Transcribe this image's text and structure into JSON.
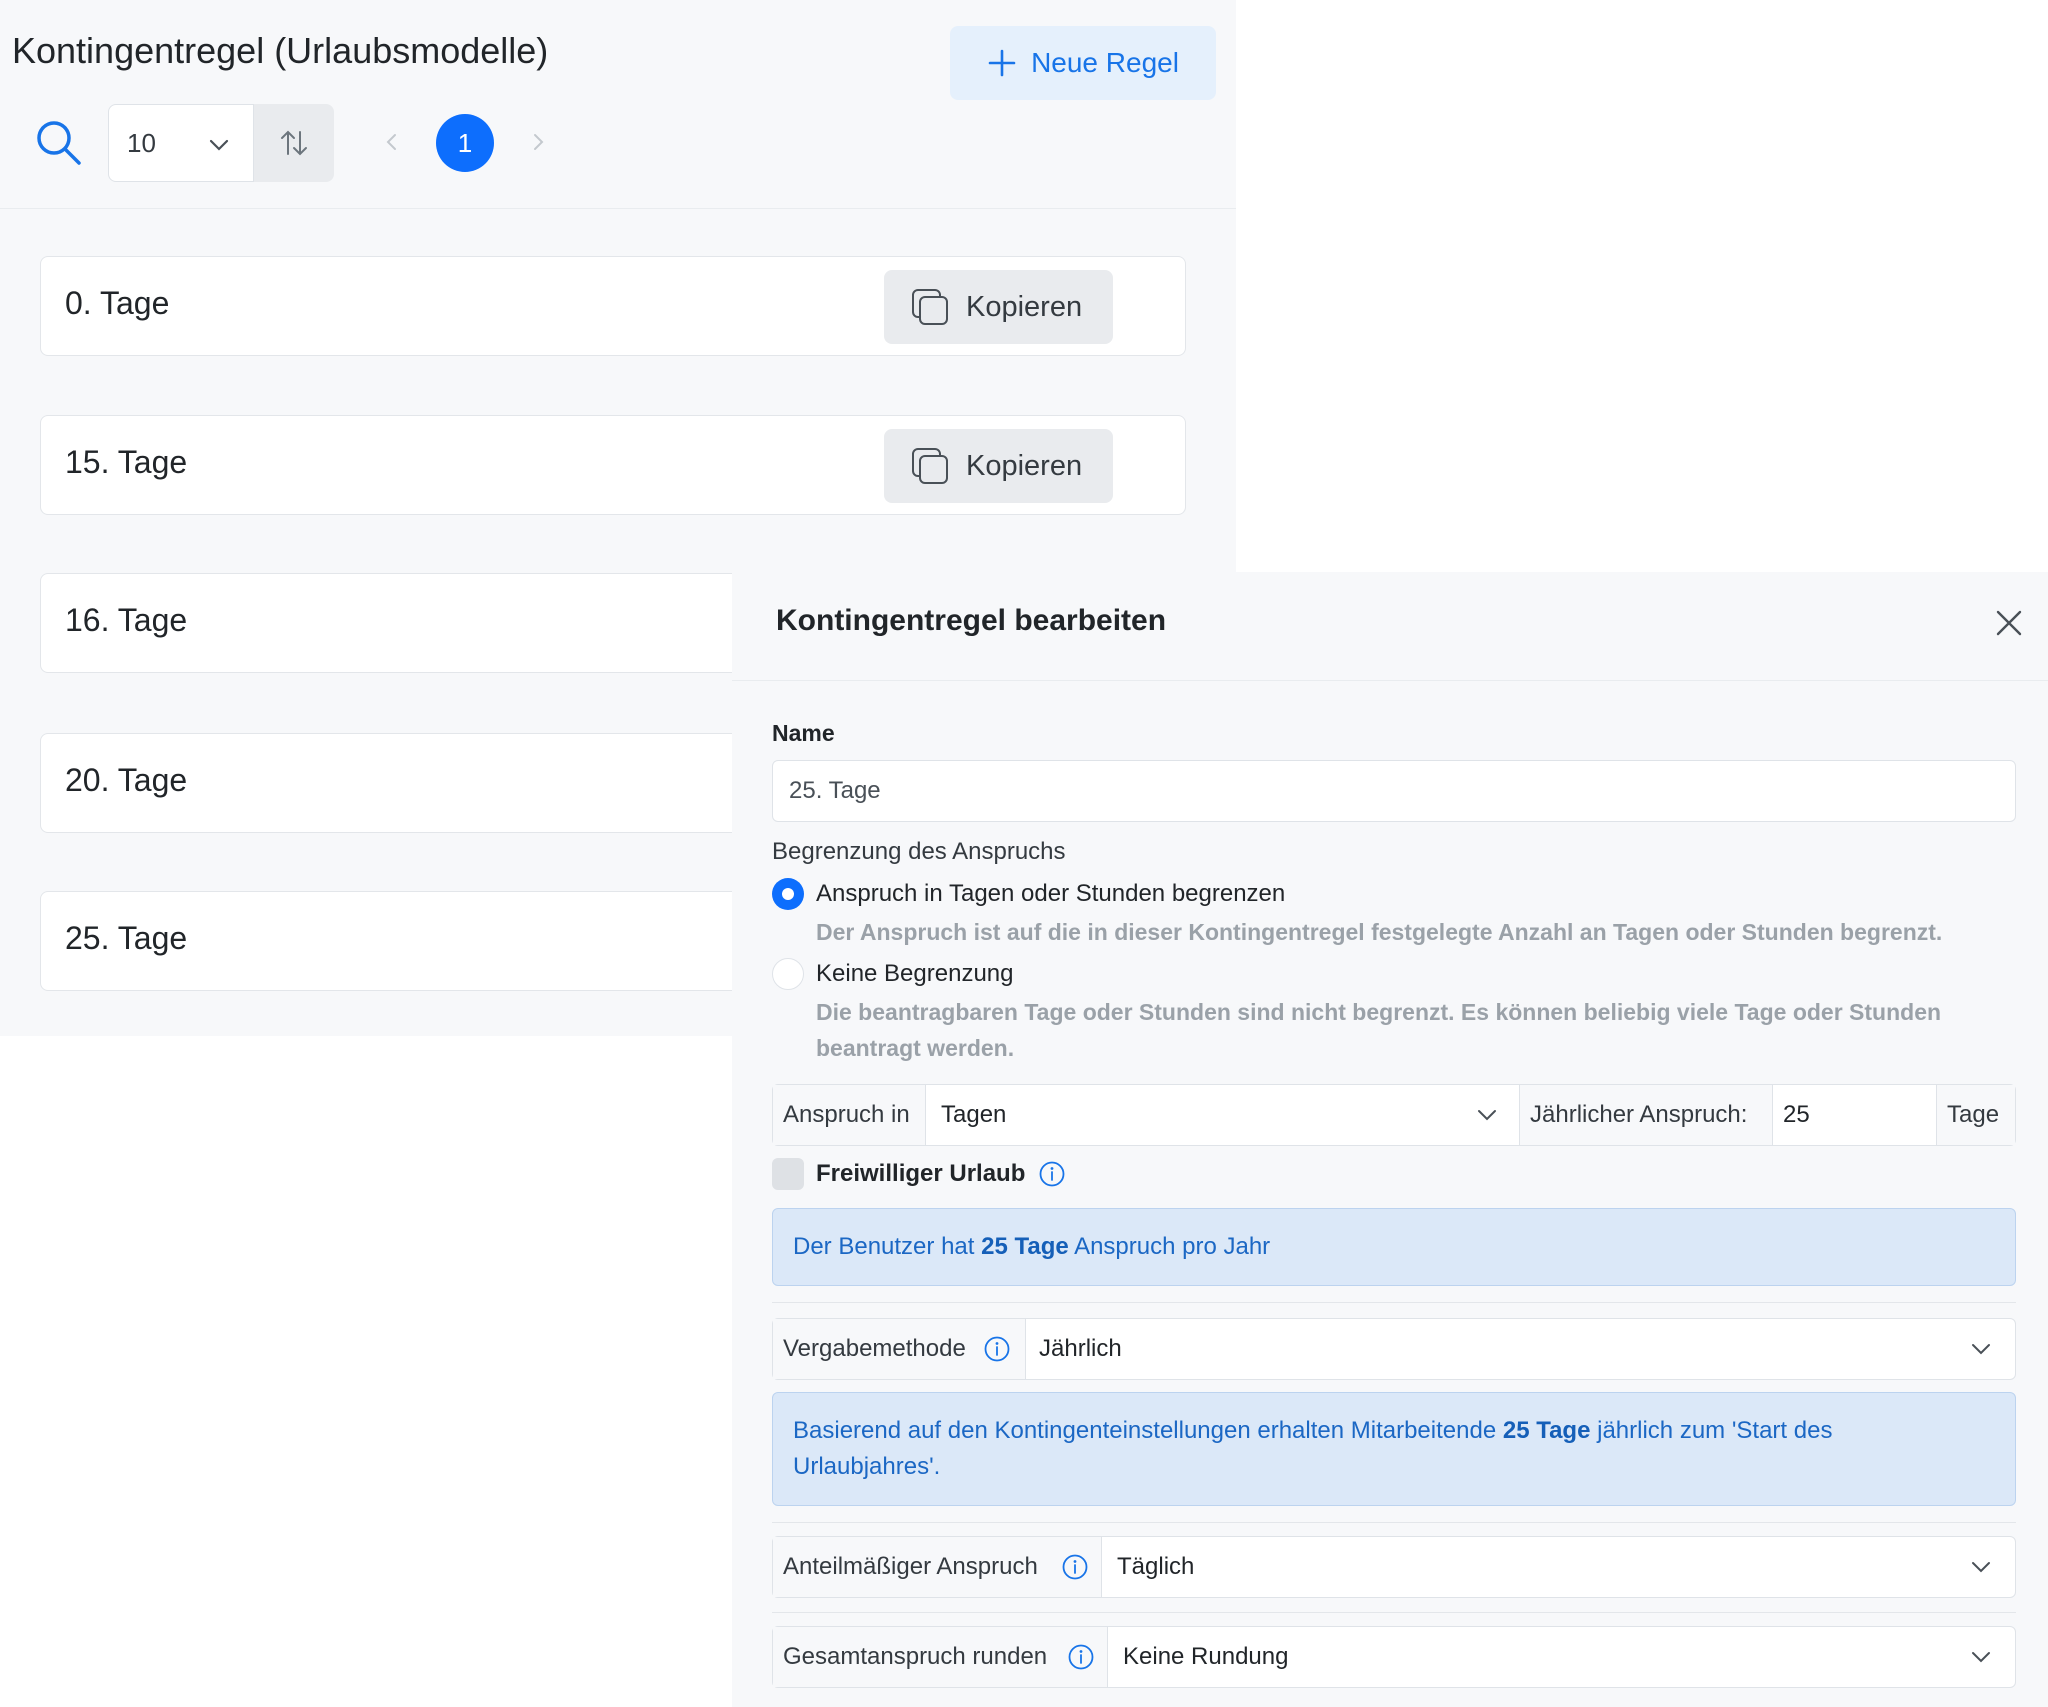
{
  "list": {
    "title": "Kontingentregel (Urlaubsmodelle)",
    "new_rule_label": "Neue Regel",
    "page_size": "10",
    "current_page": "1",
    "rules": [
      {
        "name": "0. Tage",
        "copy_label": "Kopieren"
      },
      {
        "name": "15. Tage",
        "copy_label": "Kopieren"
      },
      {
        "name": "16. Tage"
      },
      {
        "name": "20. Tage"
      },
      {
        "name": "25. Tage"
      }
    ]
  },
  "drawer": {
    "title": "Kontingentregel bearbeiten",
    "name_label": "Name",
    "name_value": "25. Tage",
    "limit_label": "Begrenzung des Anspruchs",
    "radio_options": [
      {
        "label": "Anspruch in Tagen oder Stunden begrenzen",
        "help": "Der Anspruch ist auf die in dieser Kontingentregel festgelegte Anzahl an Tagen oder Stunden begrenzt.",
        "selected": true
      },
      {
        "label": "Keine Begrenzung",
        "help_line1": "Die beantragbaren Tage oder Stunden sind nicht begrenzt. Es können beliebig viele Tage oder Stunden",
        "help_line2": "beantragt werden.",
        "selected": false
      }
    ],
    "claim_in_label": "Anspruch in",
    "claim_in_value": "Tagen",
    "annual_claim_label": "Jährlicher Anspruch:",
    "annual_claim_value": "25",
    "annual_claim_unit": "Tage",
    "voluntary_label": "Freiwilliger Urlaub",
    "summary_prefix": "Der Benutzer hat ",
    "summary_bold": "25 Tage",
    "summary_suffix": " Anspruch pro Jahr",
    "method_label": "Vergabemethode",
    "method_value": "Jährlich",
    "method_info_prefix": "Basierend auf den Kontingenteinstellungen erhalten Mitarbeitende ",
    "method_info_bold": "25 Tage",
    "method_info_suffix": " jährlich zum 'Start des",
    "method_info_line2": "Urlaubjahres'.",
    "prorata_label": "Anteilmäßiger Anspruch",
    "prorata_value": "Täglich",
    "rounding_label": "Gesamtanspruch runden",
    "rounding_value": "Keine Rundung"
  },
  "colors": {
    "accent": "#0d6efd",
    "info_bg": "#dbe8f8",
    "info_text": "#1b67c4"
  }
}
